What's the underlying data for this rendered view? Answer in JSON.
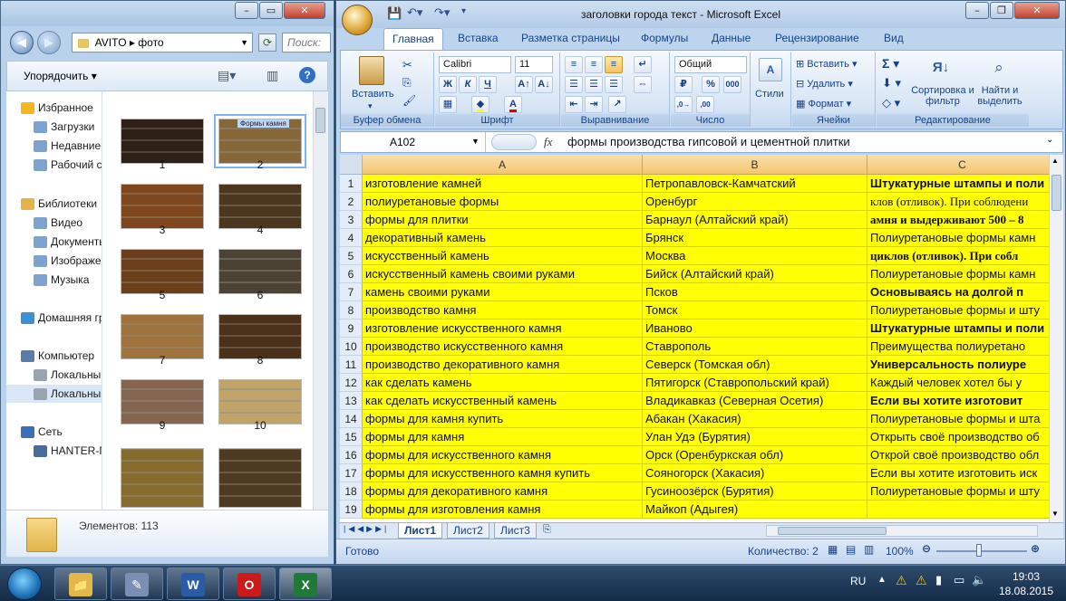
{
  "explorer": {
    "path": [
      "AVITO",
      "фото"
    ],
    "search_placeholder": "Поиск:",
    "toolbar": {
      "organize": "Упорядочить"
    },
    "nav": [
      {
        "label": "Избранное",
        "icon": "star-icon",
        "group": true
      },
      {
        "label": "Загрузки",
        "icon": "downloads-folder-icon"
      },
      {
        "label": "Недавние места",
        "icon": "recent-places-icon"
      },
      {
        "label": "Рабочий стол",
        "icon": "desktop-icon"
      },
      {
        "label": "Библиотеки",
        "icon": "libraries-icon",
        "group": true
      },
      {
        "label": "Видео",
        "icon": "video-library-icon"
      },
      {
        "label": "Документы",
        "icon": "documents-library-icon"
      },
      {
        "label": "Изображения",
        "icon": "pictures-library-icon"
      },
      {
        "label": "Музыка",
        "icon": "music-library-icon"
      },
      {
        "label": "Домашняя группа",
        "icon": "homegroup-icon",
        "group": true
      },
      {
        "label": "Компьютер",
        "icon": "computer-icon",
        "group": true
      },
      {
        "label": "Локальный диск (C:)",
        "icon": "local-disk-icon"
      },
      {
        "label": "Локальный диск (D:)",
        "icon": "local-disk-icon",
        "selected": true
      },
      {
        "label": "Сеть",
        "icon": "network-icon",
        "group": true
      },
      {
        "label": "HANTER-ПК",
        "icon": "network-computer-icon"
      }
    ],
    "thumbs": [
      {
        "label": "1",
        "color": "#6b5a4a"
      },
      {
        "label": "2",
        "color": "#b9a27a",
        "selected": true
      },
      {
        "label": "3",
        "color": "#b58658"
      },
      {
        "label": "4",
        "color": "#8b7658"
      },
      {
        "label": "5",
        "color": "#a57e55"
      },
      {
        "label": "6",
        "color": "#8b8272"
      },
      {
        "label": "7",
        "color": "#c9ab7e"
      },
      {
        "label": "8",
        "color": "#8a6f52"
      },
      {
        "label": "9",
        "color": "#b8a08f"
      },
      {
        "label": "10",
        "color": "#ddcca3"
      },
      {
        "label": "",
        "color": "#b9a46c"
      },
      {
        "label": "",
        "color": "#8d7a5c"
      }
    ],
    "thumb2_caption": "Формы камня",
    "status": "Элементов: 113"
  },
  "excel": {
    "title": "заголовки города текст  -  Microsoft Excel",
    "tabs": [
      "Главная",
      "Вставка",
      "Разметка страницы",
      "Формулы",
      "Данные",
      "Рецензирование",
      "Вид"
    ],
    "ribbon": {
      "paste": "Вставить",
      "font": "Calibri",
      "font_size": "11",
      "number_format": "Общий",
      "styles": "Стили",
      "insert": "Вставить",
      "delete": "Удалить",
      "format": "Формат",
      "sort_filter": "Сортировка и фильтр",
      "find_select": "Найти и выделить",
      "groups": [
        "Буфер обмена",
        "Шрифт",
        "Выравнивание",
        "Число",
        "Ячейки",
        "Редактирование"
      ]
    },
    "name_box": "A102",
    "fx": "fx",
    "formula": "формы производства гипсовой и цементной плитки",
    "columns": [
      "A",
      "B",
      "C"
    ],
    "rows": [
      {
        "n": "1",
        "a": "изготовление камней",
        "b": "Петропавловск-Камчатский",
        "c": "Штукатурные штампы и поли",
        "style": "bold"
      },
      {
        "n": "2",
        "a": "полиуретановые формы",
        "b": "Оренбург",
        "c": "клов (отливок). При соблюдени",
        "style": "serif"
      },
      {
        "n": "3",
        "a": "формы для плитки",
        "b": "Барнаул (Алтайский край)",
        "c": "амня и выдерживают 500 – 8",
        "style": "serif-bold"
      },
      {
        "n": "4",
        "a": "декоративный камень",
        "b": "Брянск",
        "c": "Полиуретановые формы камн",
        "style": ""
      },
      {
        "n": "5",
        "a": "искусственный камень",
        "b": "Москва",
        "c": "циклов (отливок). При собл",
        "style": "serif-bold"
      },
      {
        "n": "6",
        "a": "искусственный камень своими руками",
        "b": "Бийск (Алтайский край)",
        "c": "Полиуретановые формы камн",
        "style": ""
      },
      {
        "n": "7",
        "a": "камень своими руками",
        "b": "Псков",
        "c": "Основываясь на долгой п",
        "style": "bold"
      },
      {
        "n": "8",
        "a": "производство камня",
        "b": "Томск",
        "c": "Полиуретановые формы и шту",
        "style": ""
      },
      {
        "n": "9",
        "a": "изготовление искусственного камня",
        "b": "Иваново",
        "c": "Штукатурные штампы и поли",
        "style": "bold"
      },
      {
        "n": "10",
        "a": "производство искусственного камня",
        "b": "Ставрополь",
        "c": "Преимущества полиуретано",
        "style": ""
      },
      {
        "n": "11",
        "a": "производство декоративного камня",
        "b": "Северск (Томская обл)",
        "c": "Универсальность полиуре",
        "style": "bold"
      },
      {
        "n": "12",
        "a": "как сделать камень",
        "b": "Пятигорск (Ставропольский край)",
        "c": "Каждый человек хотел бы у",
        "style": ""
      },
      {
        "n": "13",
        "a": "как сделать искусственный камень",
        "b": "Владикавказ (Северная Осетия)",
        "c": "Если вы хотите изготовит",
        "style": "bold"
      },
      {
        "n": "14",
        "a": "формы для камня купить",
        "b": "Абакан (Хакасия)",
        "c": "Полиуретановые формы и шта",
        "style": ""
      },
      {
        "n": "15",
        "a": "формы для камня",
        "b": "Улан Удэ (Бурятия)",
        "c": "Открыть своё производство об",
        "style": ""
      },
      {
        "n": "16",
        "a": "формы для искусственного камня",
        "b": "Орск (Оренбуркская обл)",
        "c": "Открой своё производство обл",
        "style": ""
      },
      {
        "n": "17",
        "a": "формы для искусственного камня купить",
        "b": "Сояногорск (Хакасия)",
        "c": "Если вы хотите изготовить иск",
        "style": ""
      },
      {
        "n": "18",
        "a": "формы для декоративного камня",
        "b": "Гусиноозёрск  (Бурятия)",
        "c": "Полиуретановые формы и шту",
        "style": ""
      },
      {
        "n": "19",
        "a": "формы для изготовления камня",
        "b": "Майкоп (Адыгея)",
        "c": "",
        "style": ""
      }
    ],
    "sheets": [
      "Лист1",
      "Лист2",
      "Лист3"
    ],
    "status": {
      "ready": "Готово",
      "count": "Количество: 2",
      "zoom": "100%"
    }
  },
  "taskbar": {
    "lang": "RU",
    "time": "19:03",
    "date": "18.08.2015",
    "apps": [
      {
        "name": "explorer",
        "glyph": "📁",
        "color": "#e3b84b"
      },
      {
        "name": "pinned-app",
        "glyph": "✎",
        "color": "#7b8fb5"
      },
      {
        "name": "word",
        "glyph": "W",
        "color": "#2a5aa8"
      },
      {
        "name": "opera",
        "glyph": "O",
        "color": "#cc1a1a"
      },
      {
        "name": "excel",
        "glyph": "X",
        "color": "#1f7a3a"
      }
    ]
  }
}
